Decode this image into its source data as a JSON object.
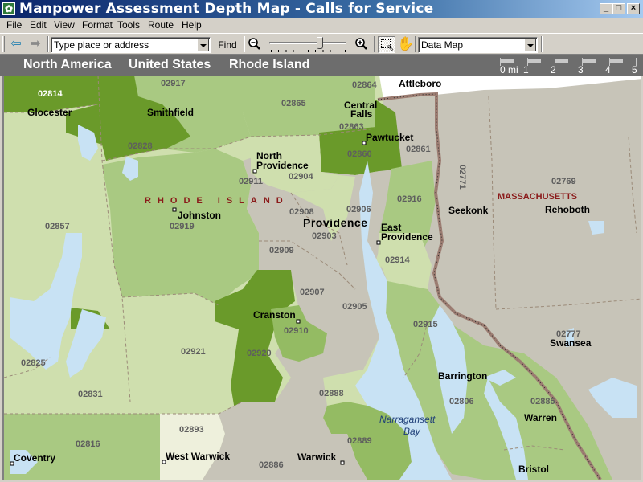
{
  "window": {
    "title": "Manpower Assessment Depth Map - Calls for Service",
    "controls": [
      "minimize",
      "maximize",
      "close"
    ]
  },
  "menu": {
    "items": [
      {
        "label": "File",
        "accel": "F"
      },
      {
        "label": "Edit",
        "accel": "E"
      },
      {
        "label": "View",
        "accel": "V"
      },
      {
        "label": "Format",
        "accel": "o"
      },
      {
        "label": "Tools",
        "accel": "T"
      },
      {
        "label": "Route",
        "accel": "u"
      },
      {
        "label": "Help",
        "accel": "H"
      }
    ]
  },
  "toolbar": {
    "back_icon": "back-arrow-icon",
    "forward_icon": "forward-arrow-icon",
    "search_value": "Type place or address",
    "find_label": "Find",
    "zoom_out_icon": "zoom-out-icon",
    "zoom_in_icon": "zoom-in-icon",
    "zoom_level_fraction": 0.66,
    "select_tool_icon": "rectangle-select-icon",
    "pan_tool_icon": "hand-pan-icon",
    "map_type_value": "Data Map"
  },
  "breadcrumb": {
    "items": [
      "North America",
      "United States",
      "Rhode Island"
    ]
  },
  "scale": {
    "unit_label": "0 mi",
    "ticks": [
      "1",
      "2",
      "3",
      "4",
      "5"
    ]
  },
  "map": {
    "colors": {
      "water": "#c8e2f4",
      "out_of_state": "#c7c4b8",
      "level_lightest": "#eef0dc",
      "level_light": "#cfdfae",
      "level_mid": "#a9c982",
      "level_mid_dark": "#94bb63",
      "level_dark": "#6a9a2a",
      "state_border": "#9c7d72",
      "zip_border": "#9b8a78"
    },
    "state_labels": {
      "ri": "RHODE ISLAND",
      "ma": "MASSACHUSETTS"
    },
    "water_label": [
      "Narragansett",
      "Bay"
    ],
    "towns": {
      "glocester": "Glocester",
      "smithfield": "Smithfield",
      "central_falls_1": "Central",
      "central_falls_2": "Falls",
      "pawtucket": "Pawtucket",
      "attleboro": "Attleboro",
      "north_providence_1": "North",
      "north_providence_2": "Providence",
      "johnston": "Johnston",
      "providence": "Providence",
      "east_providence_1": "East",
      "east_providence_2": "Providence",
      "seekonk": "Seekonk",
      "rehoboth": "Rehoboth",
      "cranston": "Cranston",
      "swansea": "Swansea",
      "barrington": "Barrington",
      "warren": "Warren",
      "bristol": "Bristol",
      "coventry": "Coventry",
      "west_warwick": "West Warwick",
      "warwick": "Warwick"
    },
    "zips": {
      "z02814": "02814",
      "z02917": "02917",
      "z02864": "02864",
      "z02865": "02865",
      "z02863": "02863",
      "z02860": "02860",
      "z02861": "02861",
      "z02828": "02828",
      "z02911": "02911",
      "z02904": "02904",
      "z02771": "02771",
      "z02769": "02769",
      "z02916": "02916",
      "z02908": "02908",
      "z02906": "02906",
      "z02919": "02919",
      "z02857": "02857",
      "z02903": "02903",
      "z02909": "02909",
      "z02914": "02914",
      "z02907": "02907",
      "z02905": "02905",
      "z02910": "02910",
      "z02915": "02915",
      "z02921": "02921",
      "z02920": "02920",
      "z02777": "02777",
      "z02825": "02825",
      "z02831": "02831",
      "z02888": "02888",
      "z02806": "02806",
      "z02885": "02885",
      "z02893": "02893",
      "z02816": "02816",
      "z02889": "02889",
      "z02886": "02886"
    }
  }
}
